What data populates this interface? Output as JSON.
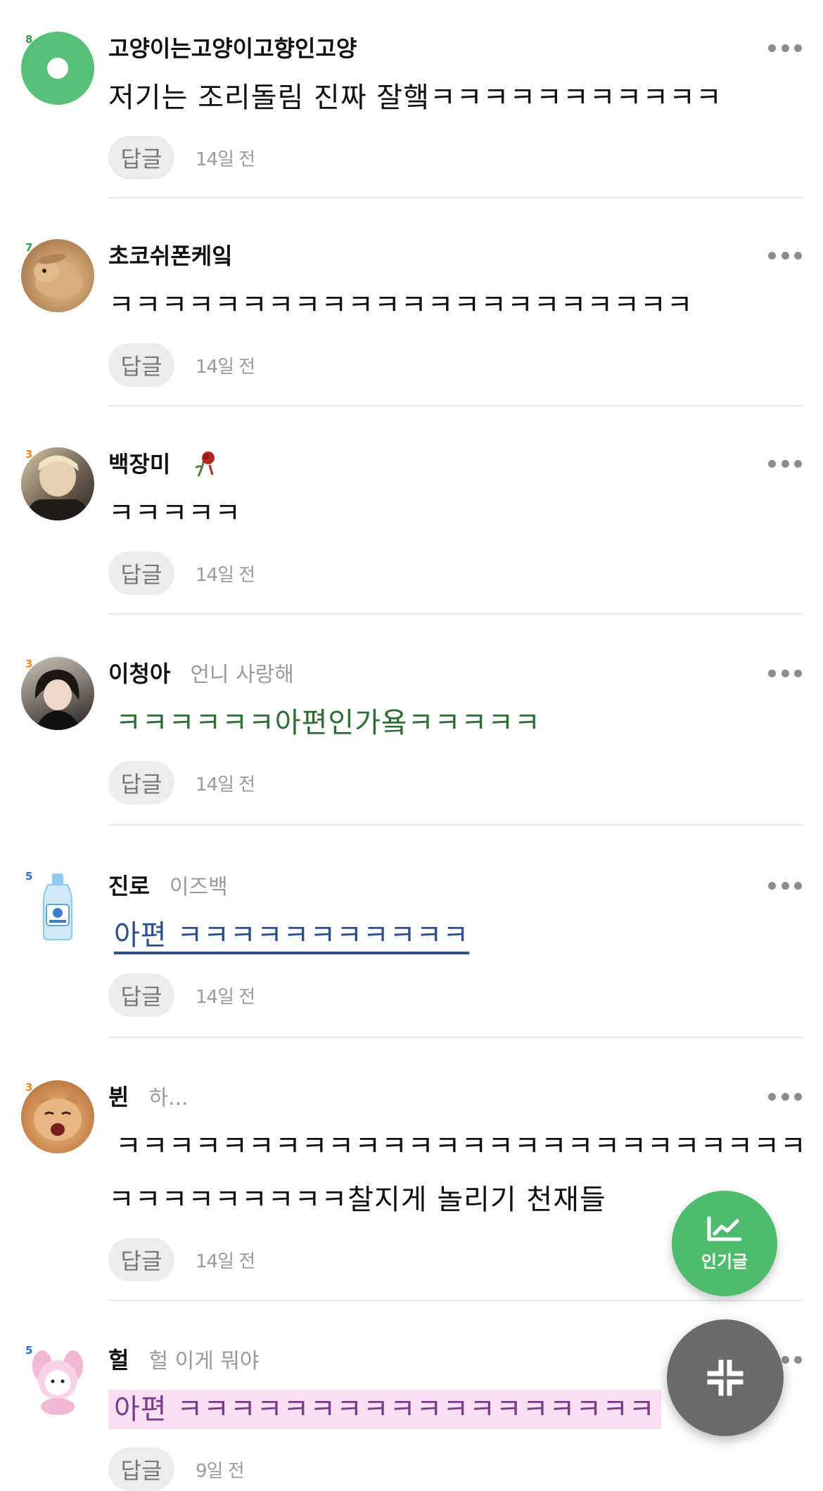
{
  "comments": [
    {
      "level": "8",
      "name": "고양이는고양이고향인고양",
      "tag": "",
      "text": "저기는 조리돌림 진짜 잘햌ㅋㅋㅋㅋㅋㅋㅋㅋㅋㅋㅋ",
      "reply": "답글",
      "time": "14일 전"
    },
    {
      "level": "7",
      "name": "초코쉬폰케잌",
      "tag": "",
      "text": "ㅋㅋㅋㅋㅋㅋㅋㅋㅋㅋㅋㅋㅋㅋㅋㅋㅋㅋㅋㅋㅋㅋ",
      "reply": "답글",
      "time": "14일 전"
    },
    {
      "level": "3",
      "name": "백장미",
      "tag": "",
      "text": "ㅋㅋㅋㅋㅋ",
      "reply": "답글",
      "time": "14일 전"
    },
    {
      "level": "3",
      "name": "이청아",
      "tag": "언니 사랑해",
      "text": "ㅋㅋㅋㅋㅋㅋ아편인가욬ㅋㅋㅋㅋㅋ",
      "reply": "답글",
      "time": "14일 전"
    },
    {
      "level": "5",
      "name": "진로",
      "tag": "이즈백",
      "text": "아편 ㅋㅋㅋㅋㅋㅋㅋㅋㅋㅋㅋ",
      "reply": "답글",
      "time": "14일 전"
    },
    {
      "level": "3",
      "name": "뷘",
      "tag": "하...",
      "text_line1": "ㅋㅋㅋㅋㅋㅋㅋㅋㅋㅋㅋㅋㅋㅋㅋㅋㅋㅋㅋㅋㅋㅋㅋㅋㅋㅋ",
      "text_line2": "ㅋㅋㅋㅋㅋㅋㅋㅋㅋ찰지게 놀리기 천재들",
      "reply": "답글",
      "time": "14일 전"
    },
    {
      "level": "5",
      "name": "헐",
      "tag": "헐 이게 뭐야",
      "text": "아편 ㅋㅋㅋㅋㅋㅋㅋㅋㅋㅋㅋㅋㅋㅋㅋㅋㅋㅋ",
      "reply": "답글",
      "time": "9일 전"
    }
  ],
  "fab": {
    "popular_label": "인기글",
    "popular_icon": "trending-chart-icon",
    "collapse_icon": "collapse-arrows-icon"
  },
  "colors": {
    "accent_green": "#4fbb6c",
    "level_orange": "#f08a2a",
    "level_blue": "#2a6fd6"
  }
}
